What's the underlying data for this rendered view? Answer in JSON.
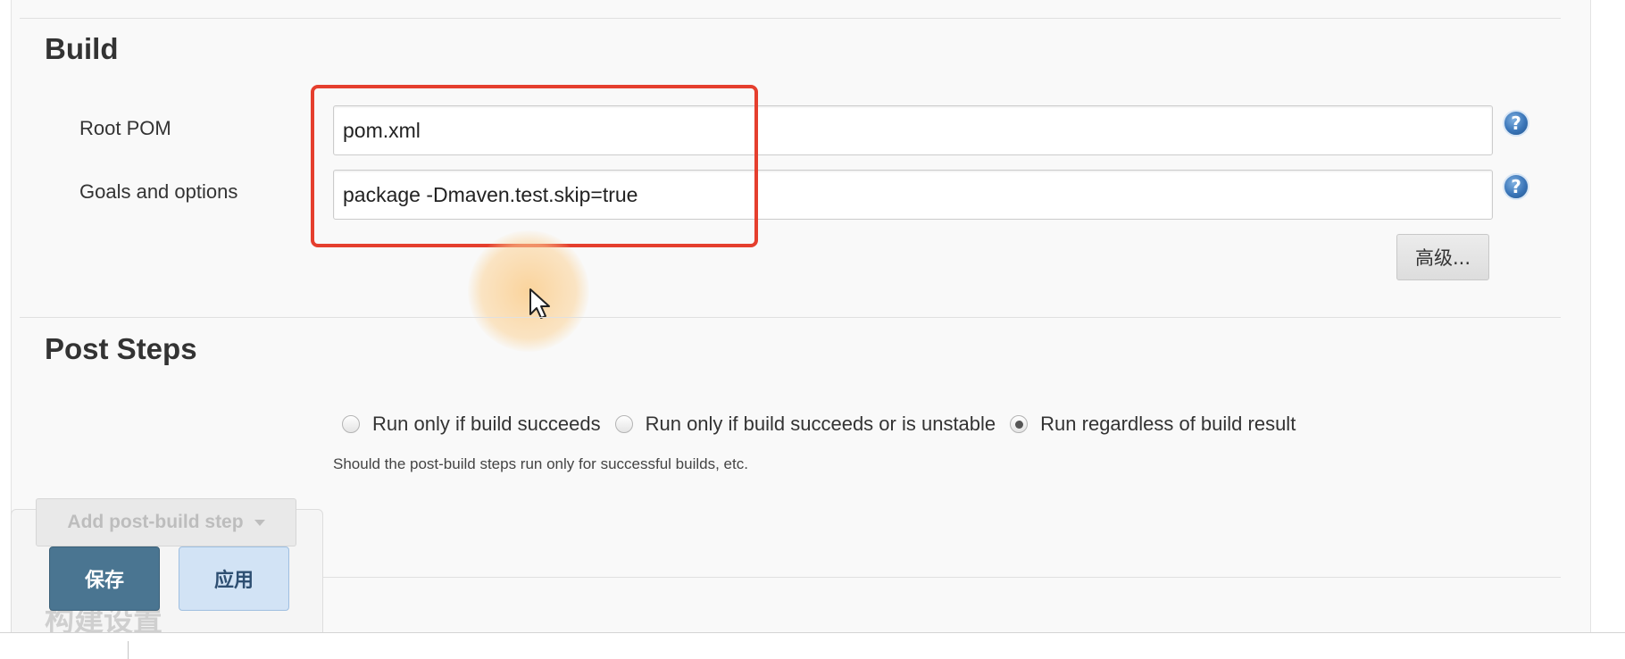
{
  "build": {
    "title": "Build",
    "root_pom": {
      "label": "Root POM",
      "value": "pom.xml"
    },
    "goals": {
      "label": "Goals and options",
      "value": "package -Dmaven.test.skip=true"
    },
    "help_glyph": "?",
    "advanced_label": "高级..."
  },
  "post_steps": {
    "title": "Post Steps",
    "options": [
      {
        "label": "Run only if build succeeds",
        "checked": false
      },
      {
        "label": "Run only if build succeeds or is unstable",
        "checked": false
      },
      {
        "label": "Run regardless of build result",
        "checked": true
      }
    ],
    "help_text": "Should the post-build steps run only for successful builds, etc.",
    "add_step_label": "Add post-build step"
  },
  "bottom_bar": {
    "save_label": "保存",
    "apply_label": "应用",
    "next_section_title": "构建设置"
  },
  "icons": {
    "help": "help-icon",
    "dropdown": "caret-down-icon",
    "cursor": "mouse-pointer-icon"
  },
  "colors": {
    "highlight": "#e53f2e",
    "save_button": "#4a7591",
    "apply_button": "#d2e3f5",
    "help_icon": "#3a75b8"
  }
}
